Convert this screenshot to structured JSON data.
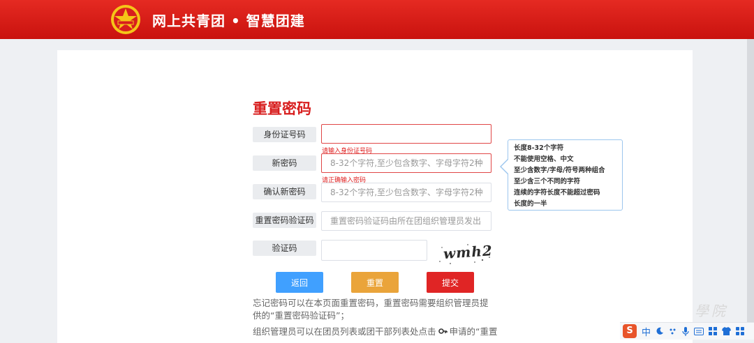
{
  "header": {
    "app_title": "网上共青团 • 智慧团建"
  },
  "form": {
    "title": "重置密码",
    "id_label": "身份证号码",
    "id_value": "",
    "id_error": "请输入身份证号码",
    "new_pw_label": "新密码",
    "new_pw_placeholder": "8-32个字符,至少包含数字、字母字符2种组合",
    "new_pw_error": "请正确输入密码",
    "confirm_pw_label": "确认新密码",
    "confirm_pw_placeholder": "8-32个字符,至少包含数字、字母字符2种组合",
    "reset_code_label": "重置密码验证码",
    "reset_code_placeholder": "重置密码验证码由所在团组织管理员发出",
    "captcha_label": "验证码",
    "captcha_value": "",
    "captcha_text": "wmh2"
  },
  "tooltip": {
    "lines": [
      "长度8-32个字符",
      "不能使用空格、中文",
      "至少含数字/字母/符号两种组合",
      "至少含三个不同的字符",
      "连续的字符长度不能超过密码",
      "长度的一半"
    ]
  },
  "buttons": {
    "back": "返回",
    "reset": "重置",
    "submit": "提交"
  },
  "notes": {
    "p1": "忘记密码可以在本页面重置密码，重置密码需要组织管理员提供的“重置密码验证码”；",
    "p2_before": "组织管理员可以在团员列表或团干部列表处点击",
    "p2_after": "申请的“重置"
  },
  "watermark": "學院",
  "ime": {
    "brand": "S",
    "mode": "中"
  },
  "colors": {
    "header_red": "#d81e1e",
    "back_blue": "#40a0ff",
    "reset_orange": "#eaa43a",
    "submit_red": "#e02525",
    "tip_border": "#9cc6ee"
  },
  "icons": [
    "party-emblem-icon",
    "key-icon",
    "moon-icon",
    "punctuation-icon",
    "microphone-icon",
    "keyboard-icon",
    "grid-icon",
    "shirt-icon",
    "apps-icon"
  ]
}
